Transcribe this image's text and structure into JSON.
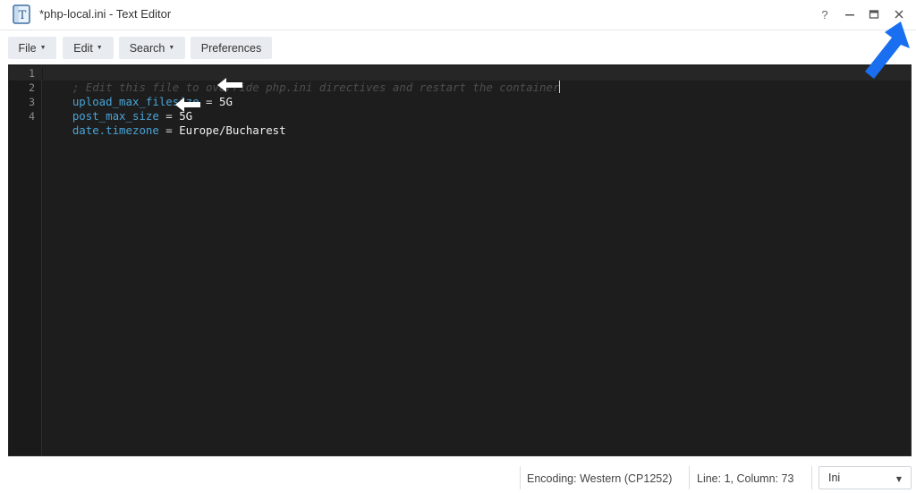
{
  "window": {
    "title": "*php-local.ini - Text Editor",
    "help_label": "?"
  },
  "toolbar": {
    "file_label": "File",
    "edit_label": "Edit",
    "search_label": "Search",
    "preferences_label": "Preferences"
  },
  "editor": {
    "line_numbers": [
      "1",
      "2",
      "3",
      "4"
    ],
    "lines": [
      {
        "comment": "; Edit this file to override php.ini directives and restart the container"
      },
      {
        "key": "upload_max_filesize",
        "eq": " = ",
        "value": "5G"
      },
      {
        "key": "post_max_size",
        "eq": " = ",
        "value": "5G"
      },
      {
        "key": "date.timezone",
        "eq": " = ",
        "value": "Europe/Bucharest"
      }
    ]
  },
  "status": {
    "encoding": "Encoding: Western (CP1252)",
    "position": "Line: 1, Column: 73",
    "mode_value": "Ini"
  },
  "colors": {
    "editor_bg": "#1d1d1d",
    "key": "#4aa3d6",
    "comment": "#4e4e4e",
    "annotation_arrow": "#1a6ff0"
  },
  "icons": {
    "app": "text-editor-icon",
    "minimize": "minimize-icon",
    "maximize": "maximize-icon",
    "close": "close-icon",
    "annotation": "blue-arrow-icon",
    "highlight": "white-arrow-icon"
  }
}
